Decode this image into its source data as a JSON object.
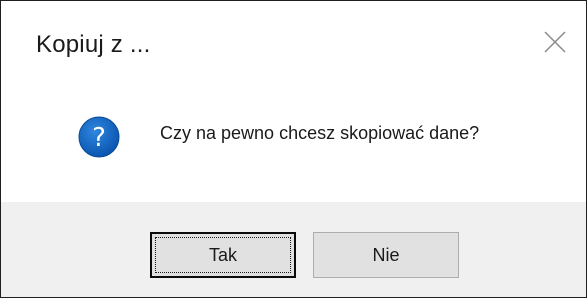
{
  "dialog": {
    "title": "Kopiuj z ...",
    "message": "Czy na pewno chcesz skopiować dane?",
    "icon": "question-icon",
    "close_icon": "close-icon"
  },
  "buttons": {
    "yes_label": "Tak",
    "no_label": "Nie"
  },
  "colors": {
    "icon_blue": "#1060c0",
    "footer_bg": "#f0f0f0",
    "button_bg": "#e1e1e1"
  }
}
